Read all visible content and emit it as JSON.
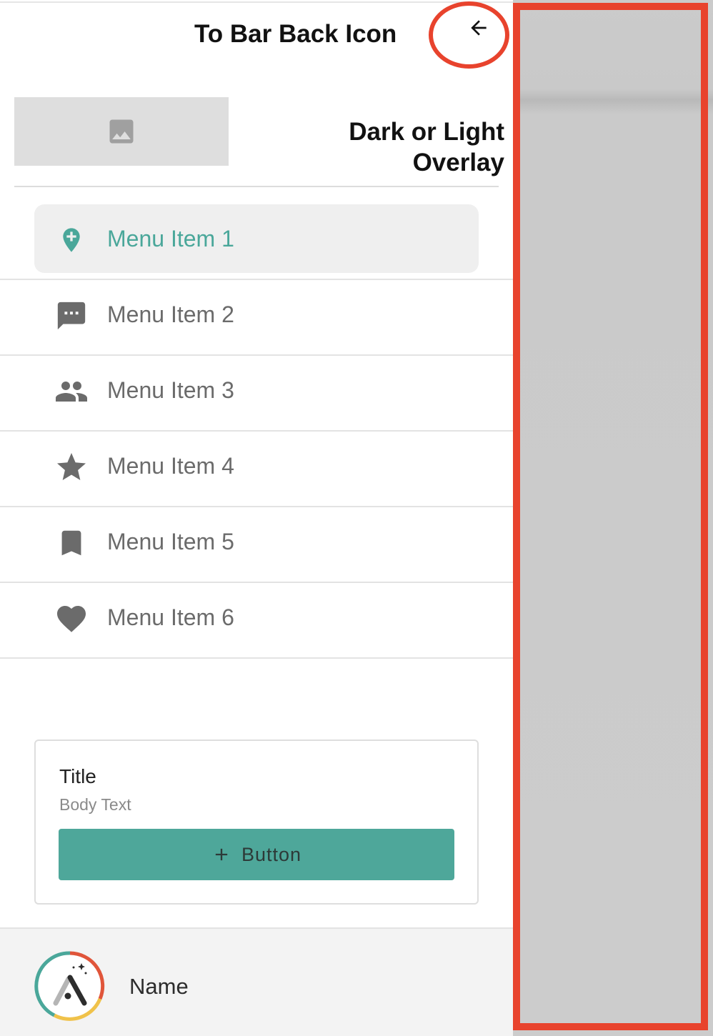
{
  "header": {
    "title": "To Bar Back Icon",
    "back_icon": "arrow-back-icon"
  },
  "hero": {
    "image_icon": "image-icon",
    "overlay_line1": "Dark or Light",
    "overlay_line2": "Overlay"
  },
  "menu": {
    "items": [
      {
        "label": "Menu Item 1",
        "icon": "add-location-icon",
        "active": true
      },
      {
        "label": "Menu Item 2",
        "icon": "chat-icon",
        "active": false
      },
      {
        "label": "Menu Item 3",
        "icon": "people-icon",
        "active": false
      },
      {
        "label": "Menu Item 4",
        "icon": "star-icon",
        "active": false
      },
      {
        "label": "Menu Item 5",
        "icon": "bookmark-icon",
        "active": false
      },
      {
        "label": "Menu Item 6",
        "icon": "heart-icon",
        "active": false
      }
    ]
  },
  "card": {
    "title": "Title",
    "body": "Body Text",
    "button_label": "Button",
    "button_icon": "plus-icon"
  },
  "footer": {
    "name": "Name",
    "avatar_icon": "logo-avatar"
  },
  "colors": {
    "accent": "#4ea79a",
    "annotation": "#e8432d",
    "scrim": "#cbcbcb"
  }
}
